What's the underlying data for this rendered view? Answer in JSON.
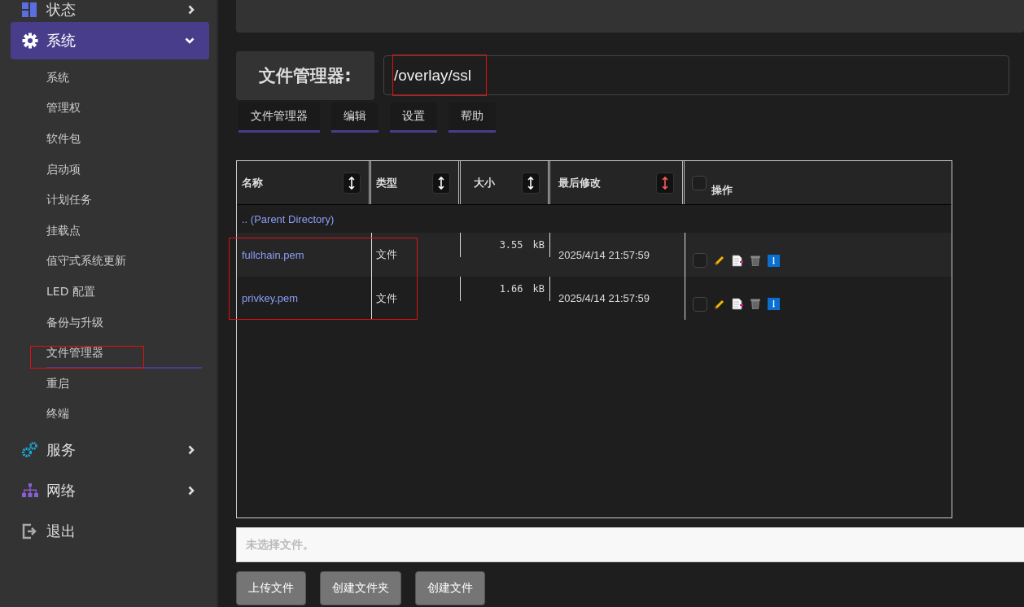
{
  "sidebar": {
    "items": [
      {
        "label": "状态",
        "expanded": false
      },
      {
        "label": "系统",
        "expanded": true,
        "children": [
          {
            "label": "系统",
            "selected": false
          },
          {
            "label": "管理权",
            "selected": false
          },
          {
            "label": "软件包",
            "selected": false
          },
          {
            "label": "启动项",
            "selected": false
          },
          {
            "label": "计划任务",
            "selected": false
          },
          {
            "label": "挂载点",
            "selected": false
          },
          {
            "label": "值守式系统更新",
            "selected": false
          },
          {
            "label": "LED 配置",
            "selected": false
          },
          {
            "label": "备份与升级",
            "selected": false
          },
          {
            "label": "文件管理器",
            "selected": true,
            "annotated": true
          },
          {
            "label": "重启",
            "selected": false
          },
          {
            "label": "终端",
            "selected": false
          }
        ]
      },
      {
        "label": "服务",
        "expanded": false
      },
      {
        "label": "网络",
        "expanded": false
      },
      {
        "label": "退出"
      }
    ]
  },
  "file_manager": {
    "title": "文件管理器:",
    "path": {
      "value": "/overlay/ssl",
      "annotated": true
    },
    "tabs": [
      {
        "label": "文件管理器"
      },
      {
        "label": "编辑"
      },
      {
        "label": "设置"
      },
      {
        "label": "帮助"
      }
    ],
    "table": {
      "columns": [
        {
          "label": "名称",
          "kind": "sort",
          "sorted": false
        },
        {
          "label": "类型",
          "kind": "sort",
          "sorted": false
        },
        {
          "label": "大小",
          "kind": "sort",
          "sorted": false
        },
        {
          "label": "最后修改",
          "kind": "sort",
          "sorted": true
        },
        {
          "label": "操作",
          "kind": "select",
          "checked": false
        }
      ],
      "parent_link": ".. (Parent Directory)",
      "rows": [
        {
          "name": "fullchain.pem",
          "type": "文件",
          "size": "3.55",
          "unit": "kB",
          "modified": "2025/4/14 21:57:59",
          "checked": false
        },
        {
          "name": "privkey.pem",
          "type": "文件",
          "size": "1.66",
          "unit": "kB",
          "modified": "2025/4/14 21:57:59",
          "checked": false
        }
      ],
      "annotated": true
    },
    "file_input": {
      "placeholder": "未选择文件。"
    },
    "buttons": [
      "上传文件",
      "创建文件夹",
      "创建文件"
    ]
  }
}
